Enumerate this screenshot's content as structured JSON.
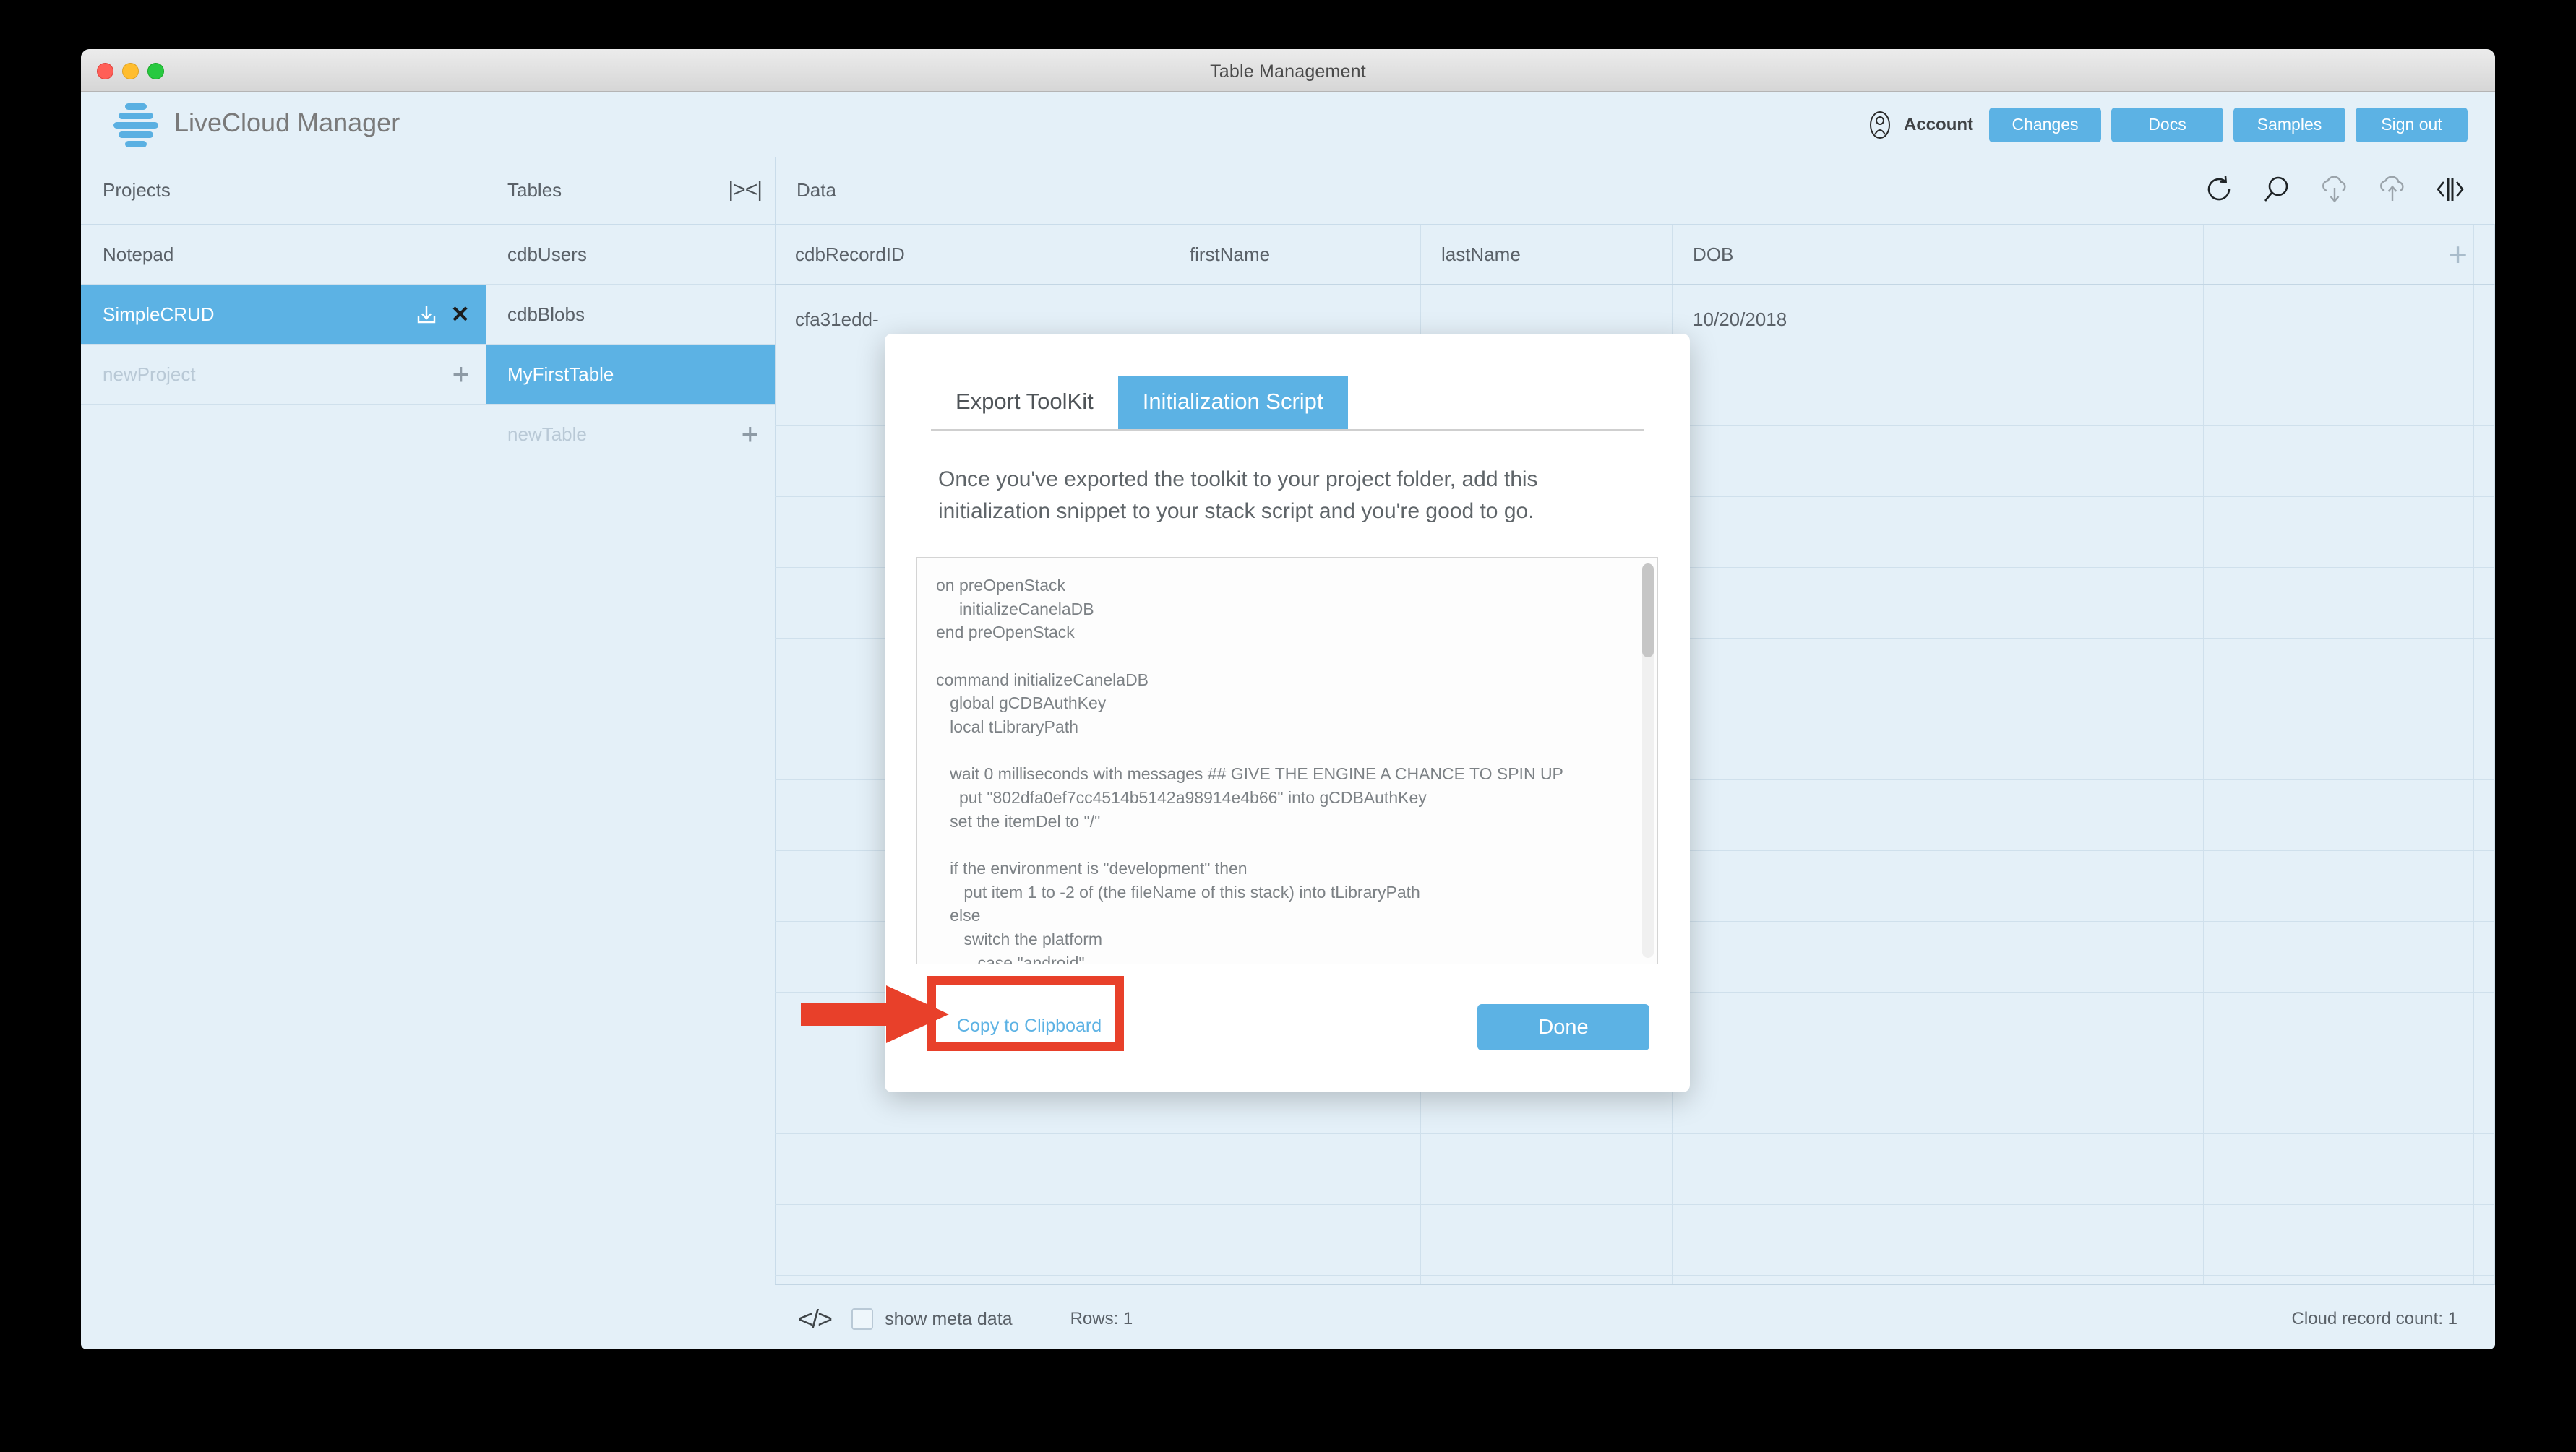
{
  "window": {
    "title": "Table Management",
    "traffic_lights": [
      "close",
      "minimize",
      "zoom"
    ]
  },
  "header": {
    "brand": "LiveCloud Manager",
    "logo_icon": "stacked-bars-logo",
    "account_icon": "user-avatar-icon",
    "account_label": "Account",
    "buttons": [
      {
        "label": "Changes",
        "name": "changes-button"
      },
      {
        "label": "Docs",
        "name": "docs-button"
      },
      {
        "label": "Samples",
        "name": "samples-button"
      },
      {
        "label": "Sign out",
        "name": "sign-out-button"
      }
    ],
    "accent_color": "#5cb2e4"
  },
  "columns": {
    "projects_label": "Projects",
    "tables_label": "Tables",
    "data_label": "Data",
    "collapse_icon": "|><|"
  },
  "toolbar": {
    "icons": [
      {
        "name": "refresh-icon"
      },
      {
        "name": "search-icon"
      },
      {
        "name": "cloud-download-icon"
      },
      {
        "name": "cloud-upload-icon"
      },
      {
        "name": "expand-panel-icon"
      }
    ]
  },
  "projects": {
    "items": [
      {
        "label": "Notepad",
        "selected": false,
        "placeholder": false
      },
      {
        "label": "SimpleCRUD",
        "selected": true,
        "placeholder": false,
        "icons": [
          "download-icon",
          "close-icon"
        ]
      },
      {
        "label": "newProject",
        "selected": false,
        "placeholder": true,
        "icons": [
          "plus-icon"
        ]
      }
    ]
  },
  "tables": {
    "items": [
      {
        "label": "cdbUsers",
        "selected": false,
        "placeholder": false
      },
      {
        "label": "cdbBlobs",
        "selected": false,
        "placeholder": false
      },
      {
        "label": "MyFirstTable",
        "selected": true,
        "placeholder": false
      },
      {
        "label": "newTable",
        "selected": false,
        "placeholder": true,
        "icons": [
          "plus-icon"
        ]
      }
    ]
  },
  "data_grid": {
    "columns": [
      "cdbRecordID",
      "firstName",
      "lastName",
      "DOB",
      "",
      ""
    ],
    "add_column_icon": "plus-icon",
    "rows": [
      [
        "cfa31edd-",
        "",
        "",
        "10/20/2018",
        "",
        ""
      ],
      [
        "",
        "",
        "",
        "",
        "",
        ""
      ],
      [
        "",
        "",
        "",
        "",
        "",
        ""
      ],
      [
        "",
        "",
        "",
        "",
        "",
        ""
      ],
      [
        "",
        "",
        "",
        "",
        "",
        ""
      ],
      [
        "",
        "",
        "",
        "",
        "",
        ""
      ],
      [
        "",
        "",
        "",
        "",
        "",
        ""
      ],
      [
        "",
        "",
        "",
        "",
        "",
        ""
      ],
      [
        "",
        "",
        "",
        "",
        "",
        ""
      ],
      [
        "",
        "",
        "",
        "",
        "",
        ""
      ],
      [
        "",
        "",
        "",
        "",
        "",
        ""
      ],
      [
        "",
        "",
        "",
        "",
        "",
        ""
      ],
      [
        "",
        "",
        "",
        "",
        "",
        ""
      ],
      [
        "",
        "",
        "",
        "",
        "",
        ""
      ],
      [
        "",
        "",
        "",
        "",
        "",
        ""
      ]
    ]
  },
  "statusbar": {
    "code_icon": "</>",
    "meta_checkbox_checked": false,
    "meta_label": "show meta data",
    "rows_label": "Rows: 1",
    "cloud_count_label": "Cloud record count: 1"
  },
  "modal": {
    "tabs": [
      {
        "label": "Export ToolKit",
        "active": false
      },
      {
        "label": "Initialization Script",
        "active": true
      }
    ],
    "description": "Once you've exported the toolkit to your project folder, add this initialization snippet to your stack script and you're good to go.",
    "code": "on preOpenStack\n     initializeCanelaDB\nend preOpenStack\n\ncommand initializeCanelaDB\n   global gCDBAuthKey\n   local tLibraryPath\n\n   wait 0 milliseconds with messages ## GIVE THE ENGINE A CHANCE TO SPIN UP\n     put \"802dfa0ef7cc4514b5142a98914e4b66\" into gCDBAuthKey\n   set the itemDel to \"/\"\n\n   if the environment is \"development\" then\n      put item 1 to -2 of (the fileName of this stack) into tLibraryPath\n   else\n      switch the platform\n         case \"android\"\n         case \"iPhone\"\n            put specialFolderPath(\"engine\") into tLibraryPath",
    "copy_link": "Copy to Clipboard",
    "done_label": "Done"
  },
  "annotation": {
    "color": "#e8402a",
    "shape": "arrow-and-box",
    "target": "Copy to Clipboard"
  }
}
